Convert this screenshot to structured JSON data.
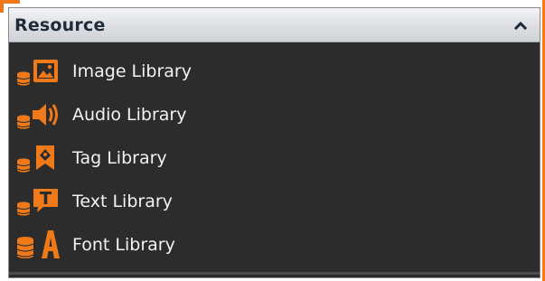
{
  "panel": {
    "title": "Resource",
    "collapse_icon": "chevron-up-icon"
  },
  "colors": {
    "accent": "#F07A1A",
    "panel_bg": "#2C2C2C",
    "header_text": "#1F2A3A",
    "item_text": "#F2F2F2"
  },
  "libraries": [
    {
      "label": "Image Library",
      "icon": "image-library-icon"
    },
    {
      "label": "Audio Library",
      "icon": "audio-library-icon"
    },
    {
      "label": "Tag Library",
      "icon": "tag-library-icon"
    },
    {
      "label": "Text Library",
      "icon": "text-library-icon"
    },
    {
      "label": "Font Library",
      "icon": "font-library-icon"
    }
  ]
}
